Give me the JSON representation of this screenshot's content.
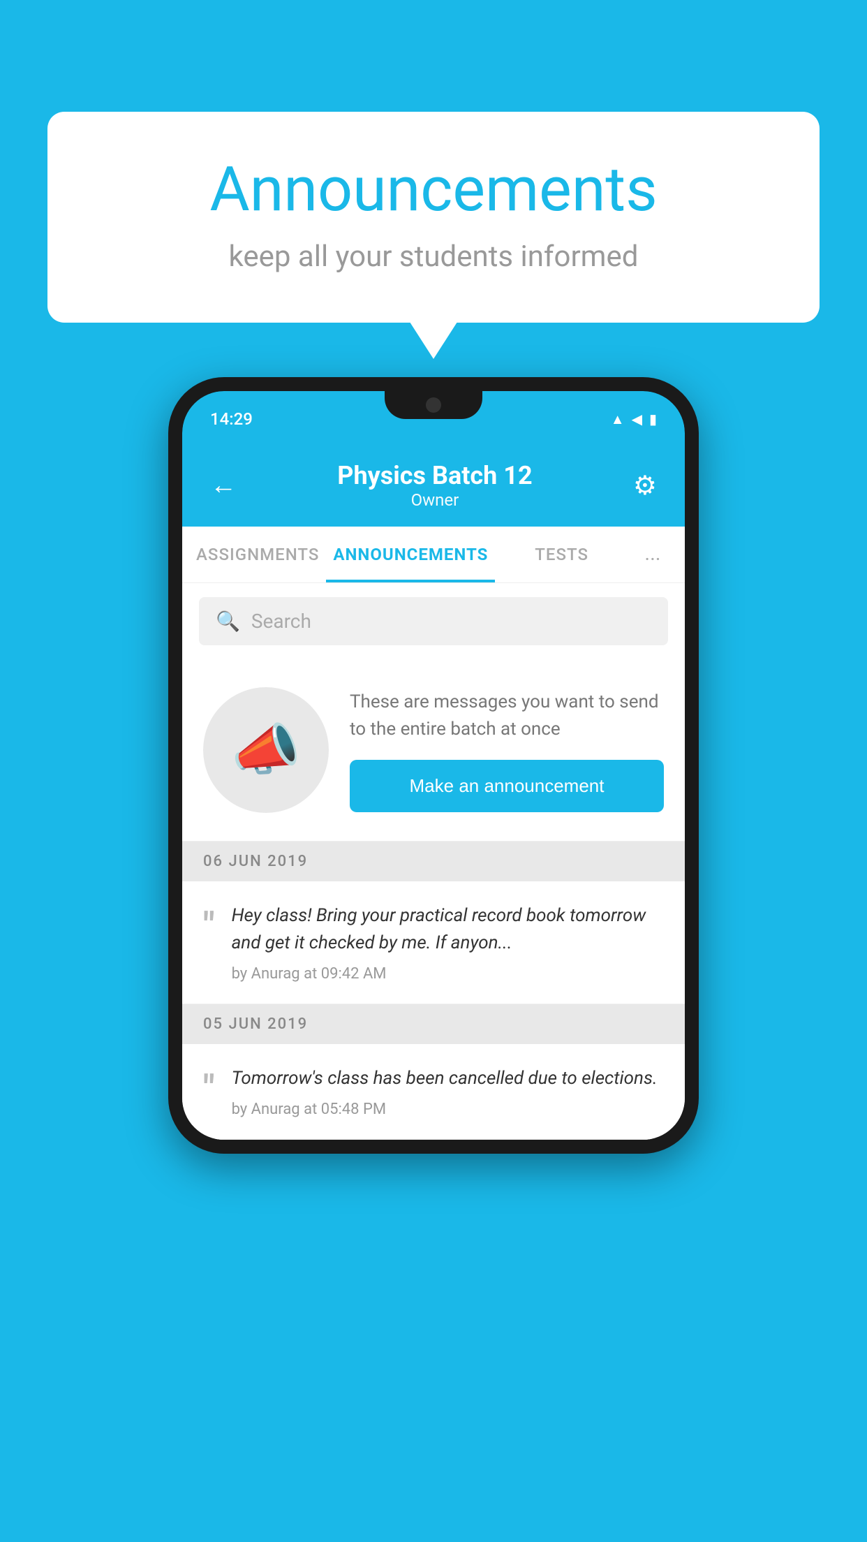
{
  "background_color": "#1ab8e8",
  "speech_bubble": {
    "title": "Announcements",
    "subtitle": "keep all your students informed"
  },
  "phone": {
    "status_bar": {
      "time": "14:29",
      "wifi_icon": "▲",
      "signal_icon": "◀",
      "battery_icon": "▮"
    },
    "header": {
      "back_label": "←",
      "title": "Physics Batch 12",
      "subtitle": "Owner",
      "gear_label": "⚙"
    },
    "tabs": [
      {
        "label": "ASSIGNMENTS",
        "active": false
      },
      {
        "label": "ANNOUNCEMENTS",
        "active": true
      },
      {
        "label": "TESTS",
        "active": false
      },
      {
        "label": "...",
        "active": false
      }
    ],
    "search": {
      "placeholder": "Search"
    },
    "cta_section": {
      "description": "These are messages you want to send to the entire batch at once",
      "button_label": "Make an announcement"
    },
    "announcements": [
      {
        "date": "06  JUN  2019",
        "text": "Hey class! Bring your practical record book tomorrow and get it checked by me. If anyon...",
        "meta": "by Anurag at 09:42 AM"
      },
      {
        "date": "05  JUN  2019",
        "text": "Tomorrow's class has been cancelled due to elections.",
        "meta": "by Anurag at 05:48 PM"
      }
    ]
  }
}
